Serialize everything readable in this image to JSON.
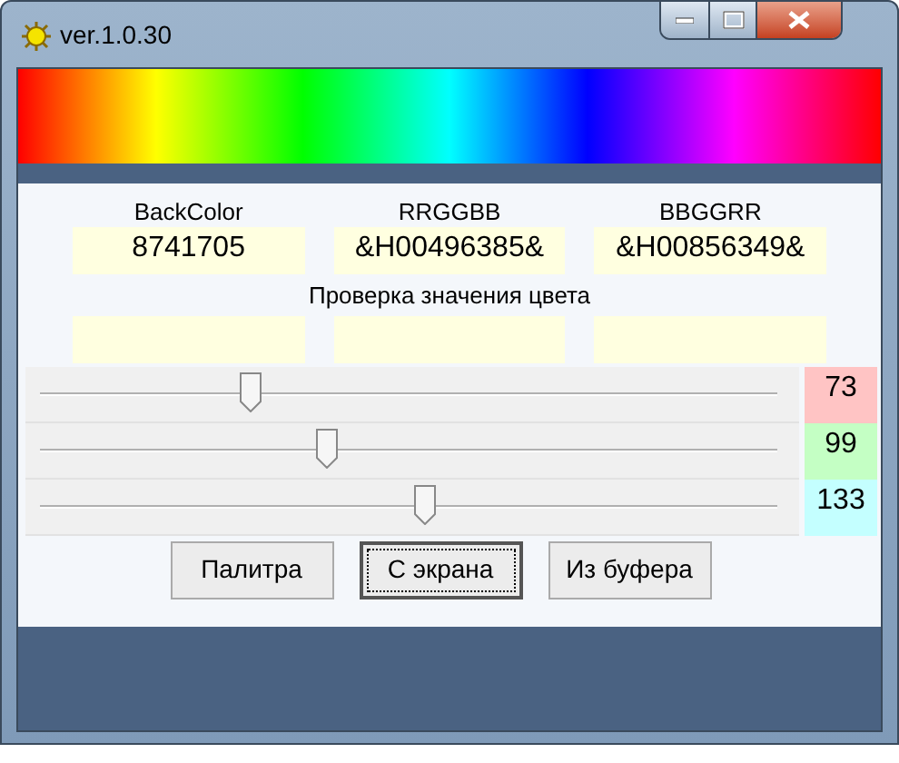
{
  "window": {
    "title": "ver.1.0.30"
  },
  "color_fields": [
    {
      "label": "BackColor",
      "value": "8741705"
    },
    {
      "label": "RRGGBB",
      "value": "&H00496385&"
    },
    {
      "label": "BBGGRR",
      "value": "&H00856349&"
    }
  ],
  "check_label": "Проверка значения цвета",
  "sliders": [
    {
      "level": 0.286,
      "reading": "73",
      "color": "#ffc4c4"
    },
    {
      "level": 0.388,
      "reading": "99",
      "color": "#c4ffc4"
    },
    {
      "level": 0.522,
      "reading": "133",
      "color": "#c4ffff"
    }
  ],
  "buttons": [
    {
      "label": "Палитра",
      "focused": false
    },
    {
      "label": "С экрана",
      "focused": true
    },
    {
      "label": "Из буфера",
      "focused": false
    }
  ]
}
